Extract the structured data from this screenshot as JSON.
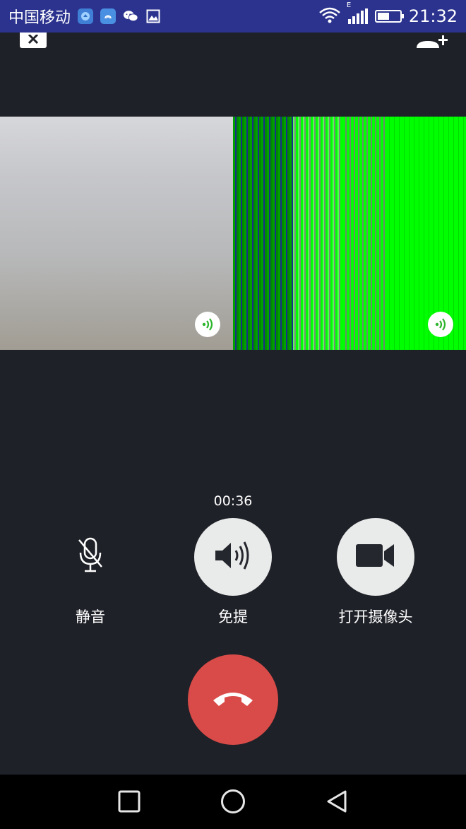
{
  "status_bar": {
    "carrier": "中国移动",
    "network_type": "E",
    "time": "21:32",
    "battery_level": 0.55,
    "icons": [
      "app-notification-icon",
      "fingerprint-app-icon",
      "wechat-icon",
      "image-icon",
      "wifi-icon",
      "cell-signal-icon",
      "battery-icon"
    ]
  },
  "top_bar": {
    "close_icon": "close-icon",
    "add_member_icon": "add-member-icon"
  },
  "videos": [
    {
      "name": "participant-video-1",
      "audio_icon": "speaking-icon"
    },
    {
      "name": "participant-video-2",
      "audio_icon": "speaking-icon"
    }
  ],
  "call": {
    "duration": "00:36",
    "controls": {
      "mute_label": "静音",
      "speaker_label": "免提",
      "camera_label": "打开摄像头"
    },
    "hangup_icon": "hangup-icon"
  },
  "colors": {
    "status_bar_bg": "#2b338e",
    "background": "#1f2128",
    "hangup": "#d94b48",
    "control_circle": "#e9eaea",
    "speaking_green": "#2cb52c"
  },
  "nav": [
    "recent-apps-icon",
    "home-icon",
    "back-icon"
  ]
}
